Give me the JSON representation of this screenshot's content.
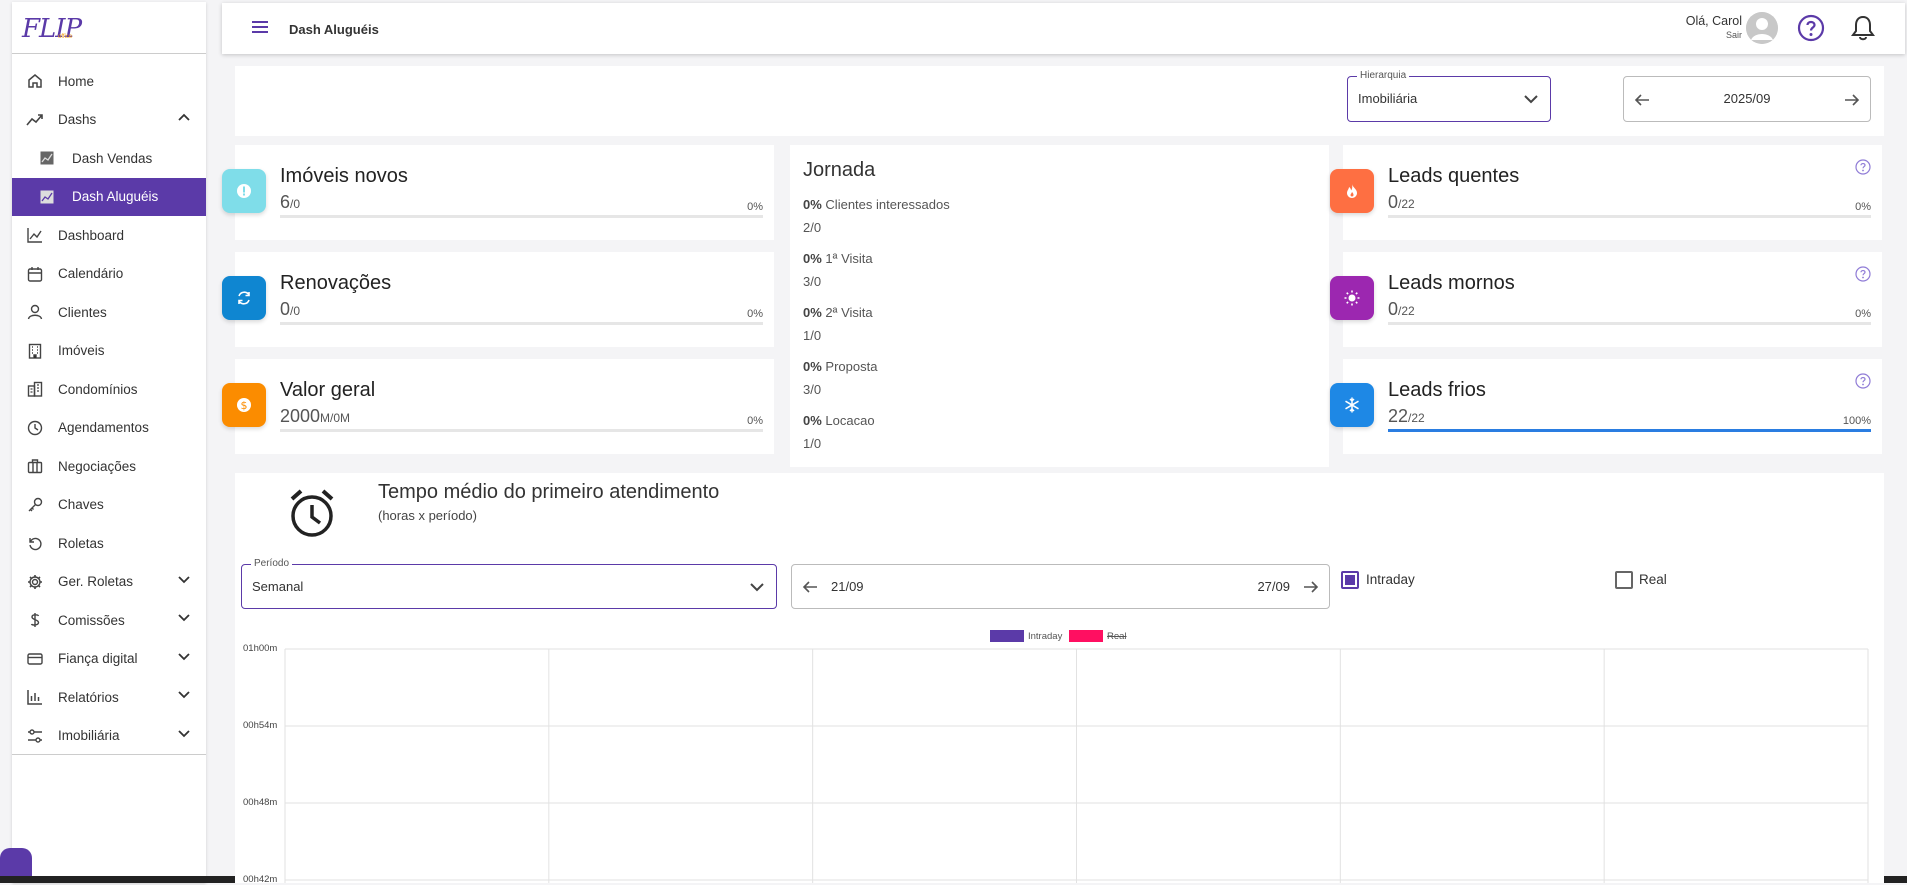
{
  "app": {
    "logo_text": "FLIP",
    "logo_sub": "office"
  },
  "sidebar": {
    "items": [
      {
        "label": "Home",
        "icon": "home-icon"
      },
      {
        "label": "Dashs",
        "icon": "trending-icon",
        "chevron": "up"
      },
      {
        "label": "Dash Vendas",
        "icon": "chart-thumb-icon",
        "sub": true
      },
      {
        "label": "Dash Aluguéis",
        "icon": "chart-thumb-icon",
        "sub": true,
        "active": true
      },
      {
        "label": "Dashboard",
        "icon": "line-chart-icon"
      },
      {
        "label": "Calendário",
        "icon": "calendar-icon"
      },
      {
        "label": "Clientes",
        "icon": "user-icon"
      },
      {
        "label": "Imóveis",
        "icon": "building-icon"
      },
      {
        "label": "Condomínios",
        "icon": "condo-icon"
      },
      {
        "label": "Agendamentos",
        "icon": "clock-icon"
      },
      {
        "label": "Negociações",
        "icon": "briefcase-icon"
      },
      {
        "label": "Chaves",
        "icon": "key-icon"
      },
      {
        "label": "Roletas",
        "icon": "refresh-icon"
      },
      {
        "label": "Ger. Roletas",
        "icon": "gear-icon",
        "chevron": "down"
      },
      {
        "label": "Comissões",
        "icon": "dollar-icon",
        "chevron": "down"
      },
      {
        "label": "Fiança digital",
        "icon": "card-icon",
        "chevron": "down"
      },
      {
        "label": "Relatórios",
        "icon": "bar-chart-icon",
        "chevron": "down"
      },
      {
        "label": "Imobiliária",
        "icon": "sliders-icon",
        "chevron": "down"
      }
    ]
  },
  "header": {
    "title": "Dash Aluguéis",
    "greeting": "Olá, Carol",
    "logout": "Sair"
  },
  "filters": {
    "hierarchy_label": "Hierarquia",
    "hierarchy_value": "Imobiliária",
    "period_value": "2025/09"
  },
  "kpis_left": [
    {
      "title": "Imóveis novos",
      "value": "6",
      "target": "/0",
      "pct": "0%",
      "color": "#7fdde9",
      "icon": "alert-badge-icon",
      "progress": 0
    },
    {
      "title": "Renovações",
      "value": "0",
      "target": "/0",
      "pct": "0%",
      "color": "#0f86d1",
      "icon": "renew-icon",
      "progress": 0
    },
    {
      "title": "Valor geral",
      "value": "2000",
      "target": "M/0M",
      "pct": "0%",
      "color": "#fb8c00",
      "icon": "money-icon",
      "progress": 0
    }
  ],
  "jornada": {
    "title": "Jornada",
    "steps": [
      {
        "pct": "0%",
        "label": "Clientes interessados",
        "count": "2/0"
      },
      {
        "pct": "0%",
        "label": "1ª Visita",
        "count": "3/0"
      },
      {
        "pct": "0%",
        "label": "2ª Visita",
        "count": "1/0"
      },
      {
        "pct": "0%",
        "label": "Proposta",
        "count": "3/0"
      },
      {
        "pct": "0%",
        "label": "Locacao",
        "count": "1/0"
      }
    ]
  },
  "kpis_right": [
    {
      "title": "Leads quentes",
      "value": "0",
      "target": "/22",
      "pct": "0%",
      "color": "#fe6f42",
      "icon": "fire-icon",
      "progress": 0
    },
    {
      "title": "Leads mornos",
      "value": "0",
      "target": "/22",
      "pct": "0%",
      "color": "#9c27b0",
      "icon": "sun-icon",
      "progress": 0
    },
    {
      "title": "Leads frios",
      "value": "22",
      "target": "/22",
      "pct": "100%",
      "color": "#1e88e5",
      "icon": "snowflake-icon",
      "progress": 1
    }
  ],
  "chart_section": {
    "title": "Tempo médio do primeiro atendimento",
    "subtitle": "(horas x período)",
    "period_label": "Período",
    "period_value": "Semanal",
    "range_start": "21/09",
    "range_end": "27/09",
    "intraday_label": "Intraday",
    "real_label": "Real",
    "intraday_checked": true,
    "real_checked": false
  },
  "chart_data": {
    "type": "bar",
    "categories": [],
    "series": [
      {
        "name": "Intraday",
        "values": [],
        "color": "#5b3aa8"
      },
      {
        "name": "Real",
        "values": [],
        "color": "#ff0f61"
      }
    ],
    "yticks": [
      "01h00m",
      "00h54m",
      "00h48m",
      "00h42m"
    ],
    "legend": "top-center",
    "grid": true
  }
}
